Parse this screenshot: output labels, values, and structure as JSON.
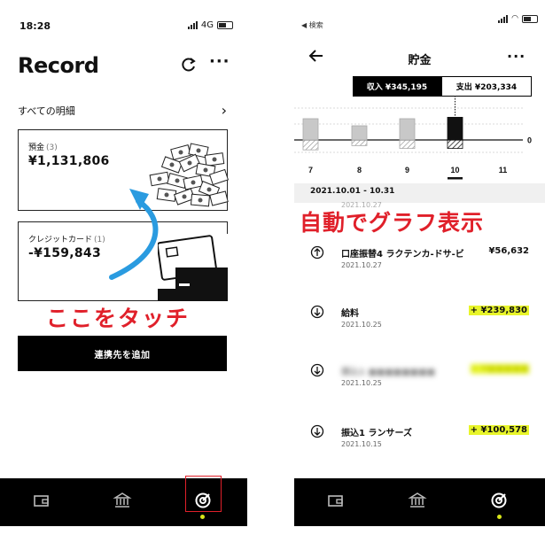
{
  "left": {
    "status": {
      "time": "18:28",
      "network": "4G"
    },
    "title": "Record",
    "all_statements": "すべての明細",
    "cards": [
      {
        "label": "預金",
        "count": "(3)",
        "amount": "¥1,131,806"
      },
      {
        "label": "クレジットカード",
        "count": "(1)",
        "amount": "-¥159,843"
      }
    ],
    "add_link_button": "連携先を追加",
    "annotation": "ここをタッチ",
    "colors": {
      "annotation": "#e0202a",
      "arrow": "#2a9be0",
      "tab_dot": "#d8e61a"
    },
    "tabs": [
      "wallet-icon",
      "bank-icon",
      "target-icon"
    ]
  },
  "right": {
    "status": {
      "back_label": "◀ 検索"
    },
    "title": "貯金",
    "income": "収入 ¥345,195",
    "expense": "支出 ¥203,334",
    "period": "2021.10.01 - 10.31",
    "partial_date": "2021.10.27",
    "annotation": "自動でグラフ表示",
    "transactions": [
      {
        "direction": "up",
        "name": "口座振替4 ラクテンカ-ドサ-ビ",
        "date": "2021.10.27",
        "amount": "¥56,632",
        "positive": false
      },
      {
        "direction": "down",
        "name": "給料",
        "date": "2021.10.25",
        "amount": "+ ¥239,830",
        "positive": true
      },
      {
        "direction": "down",
        "name": "振込1 ■■■■■■■■",
        "date": "2021.10.25",
        "amount": "+ ¥■■■■■",
        "positive": true,
        "blurred": true
      },
      {
        "direction": "down",
        "name": "振込1 ランサーズ",
        "date": "2021.10.15",
        "amount": "+ ¥100,578",
        "positive": true
      }
    ]
  },
  "chart_data": {
    "type": "bar",
    "categories": [
      "7",
      "8",
      "9",
      "10",
      "11"
    ],
    "selected": "10",
    "zero_label": "0",
    "series": [
      {
        "values": [
          1.5,
          1.0,
          1.5,
          1.6,
          0
        ]
      },
      {
        "values": [
          -0.7,
          -0.4,
          -0.6,
          -0.6,
          0
        ]
      }
    ],
    "colors": {
      "inactive": "#c8c8c8",
      "active": "#111111"
    }
  }
}
